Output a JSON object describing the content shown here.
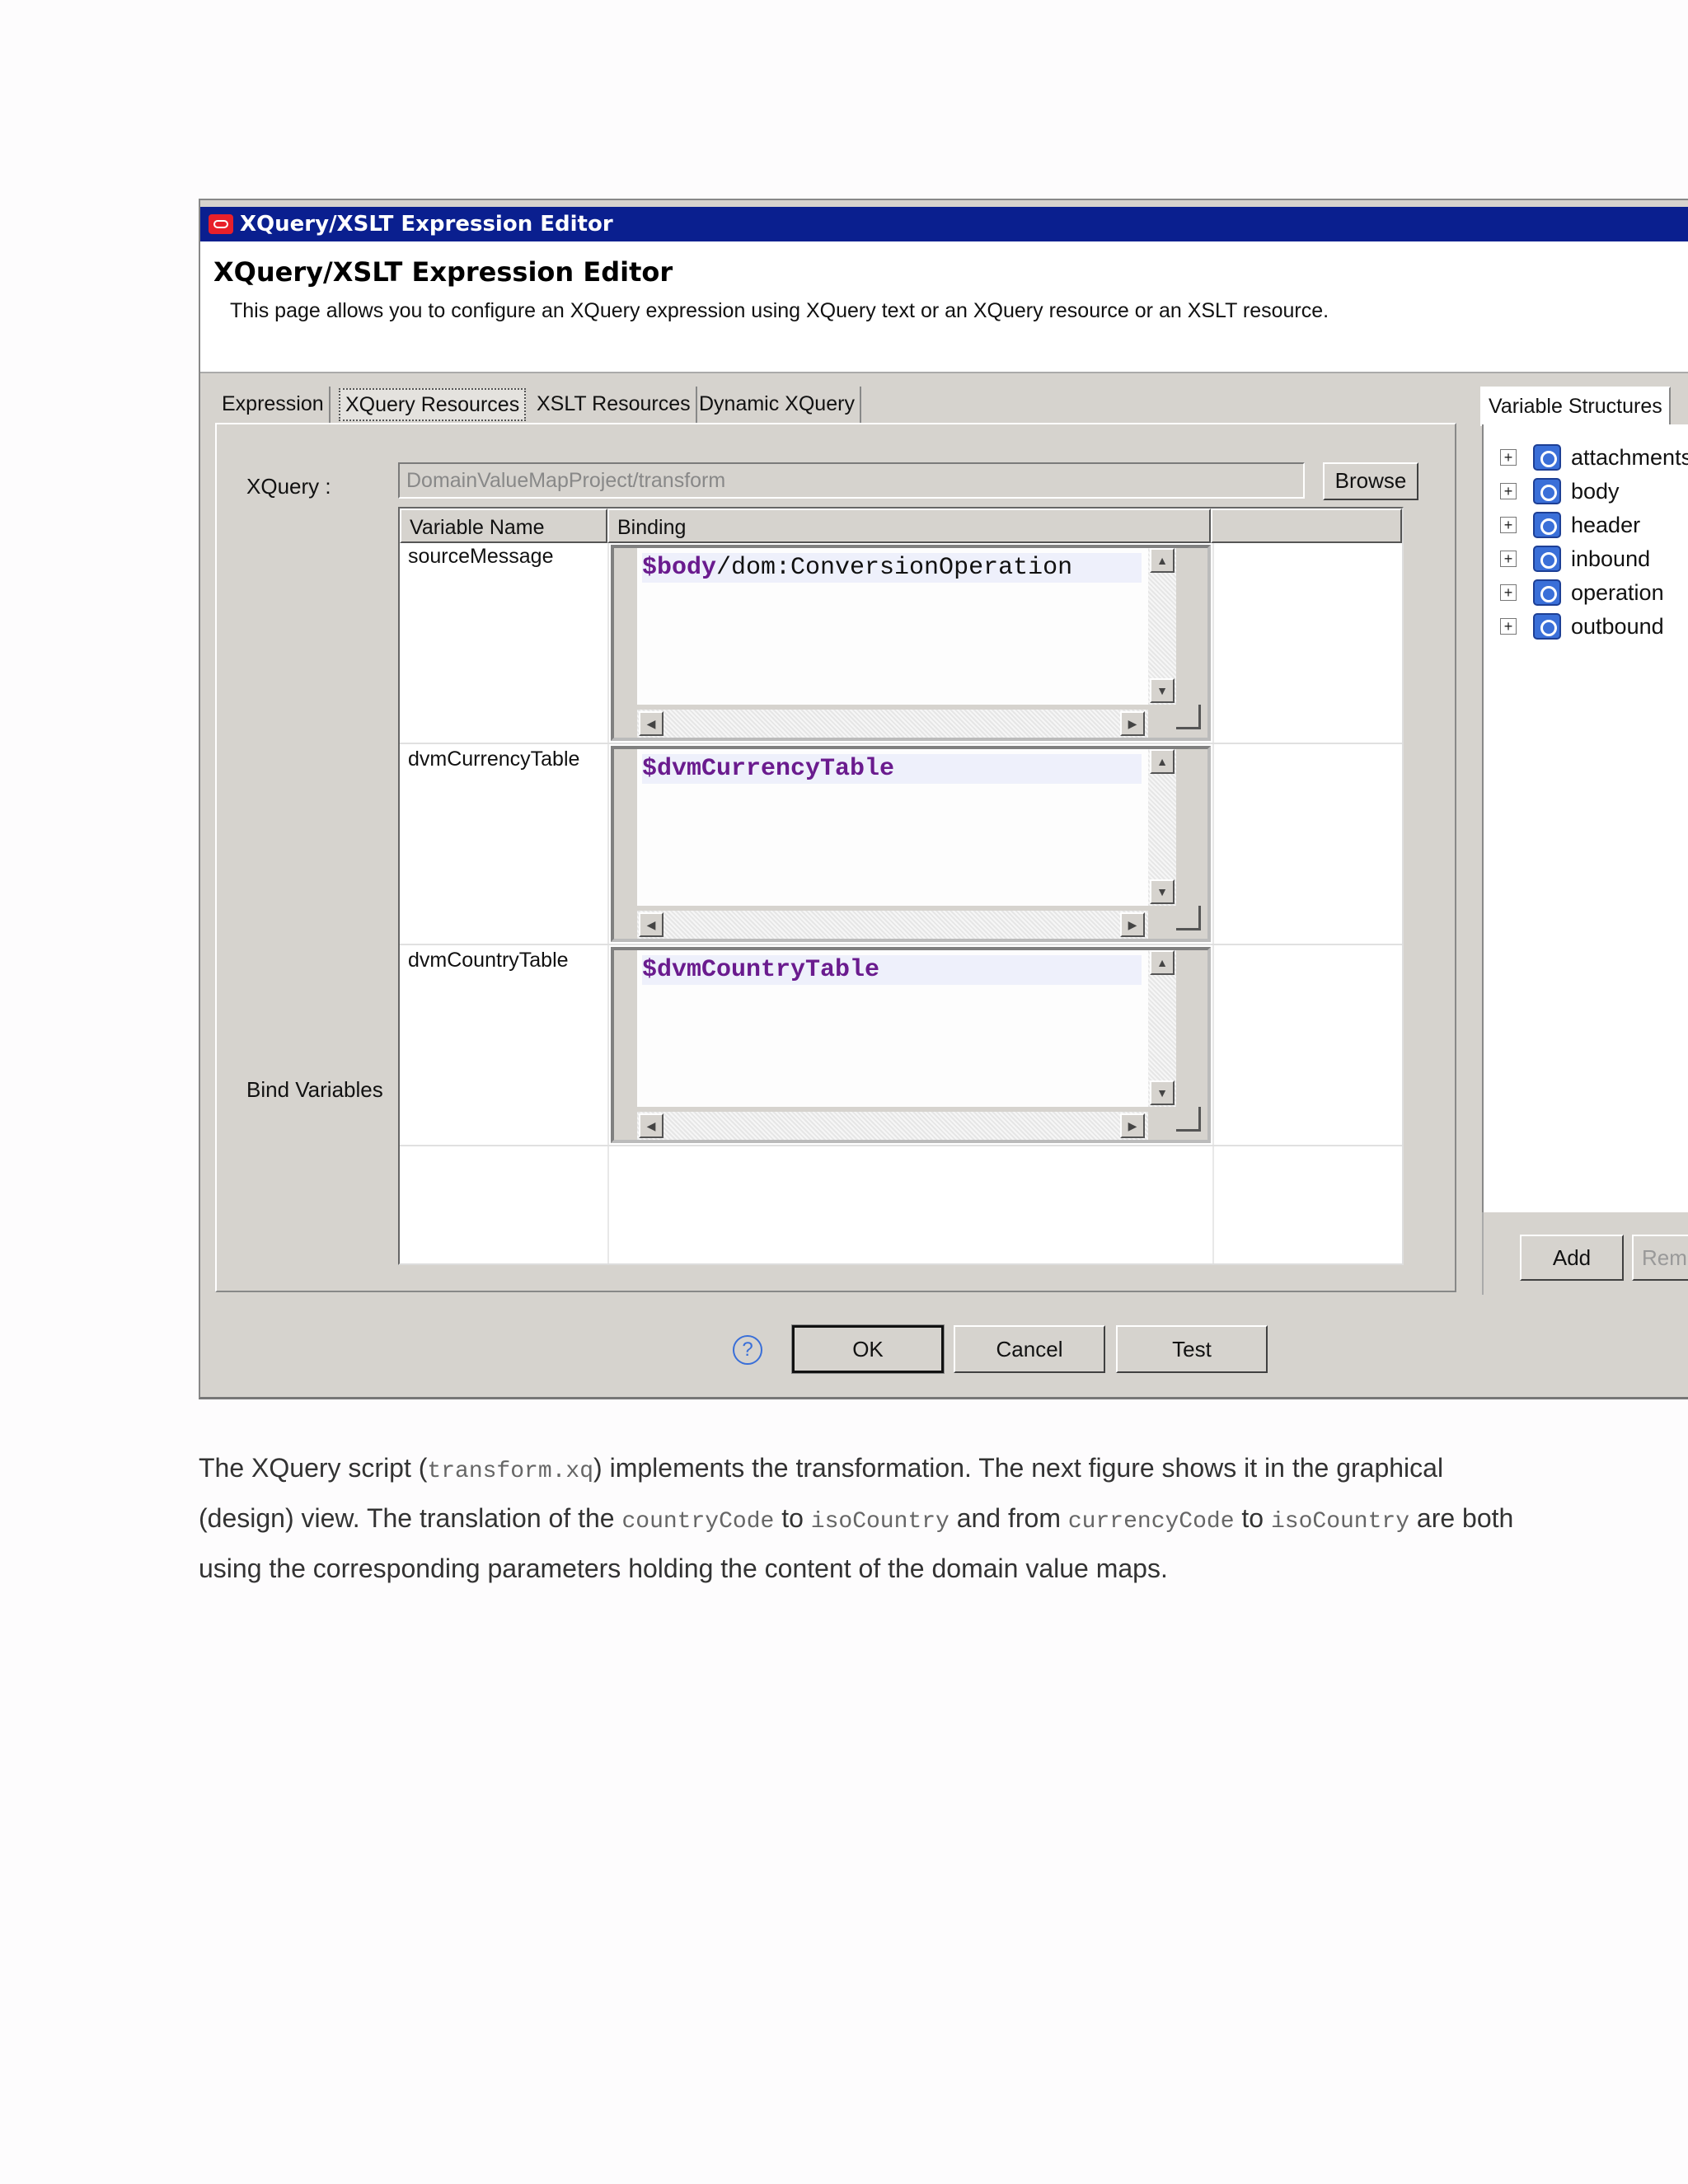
{
  "dialog": {
    "title": "XQuery/XSLT Expression Editor",
    "header_title": "XQuery/XSLT Expression Editor",
    "header_description": "This page allows you to configure an XQuery expression using XQuery text or an XQuery resource or an XSLT resource.",
    "tabs": [
      {
        "label": "Expression",
        "selected": false
      },
      {
        "label": "XQuery Resources",
        "selected": true
      },
      {
        "label": "XSLT Resources",
        "selected": false
      },
      {
        "label": "Dynamic XQuery",
        "selected": false
      }
    ],
    "xquery_label": "XQuery :",
    "xquery_value": "DomainValueMapProject/transform",
    "browse_label": "Browse",
    "bind_variables_label": "Bind Variables",
    "table": {
      "headers": [
        "Variable Name",
        "Binding"
      ],
      "rows": [
        {
          "name": "sourceMessage",
          "binding_var": "$body",
          "binding_rest": "/dom:ConversionOperation"
        },
        {
          "name": "dvmCurrencyTable",
          "binding_var": "$dvmCurrencyTable",
          "binding_rest": ""
        },
        {
          "name": "dvmCountryTable",
          "binding_var": "$dvmCountryTable",
          "binding_rest": ""
        }
      ]
    },
    "variable_structures": {
      "tab_label": "Variable Structures",
      "items": [
        "attachments",
        "body",
        "header",
        "inbound",
        "operation",
        "outbound"
      ],
      "add_label": "Add",
      "remove_label": "Rem"
    },
    "buttons": {
      "ok": "OK",
      "cancel": "Cancel",
      "test": "Test",
      "help": "?"
    }
  },
  "paragraph": {
    "t1": "The XQuery script (",
    "c1": "transform.xq",
    "t2": ") implements the transformation. The next figure shows it in the graphical (design) view. The translation of the ",
    "c2": "countryCode",
    "t3": " to ",
    "c3": "isoCountry",
    "t4": " and from ",
    "c4": "currencyCode",
    "t5": " to ",
    "c5": "isoCountry",
    "t6": " are both using the corresponding parameters holding the content of the domain value maps."
  },
  "colors": {
    "titlebar": "#0a1f8f",
    "binding_variable": "#6a1b8e",
    "dialog_bg": "#d6d3ce"
  }
}
